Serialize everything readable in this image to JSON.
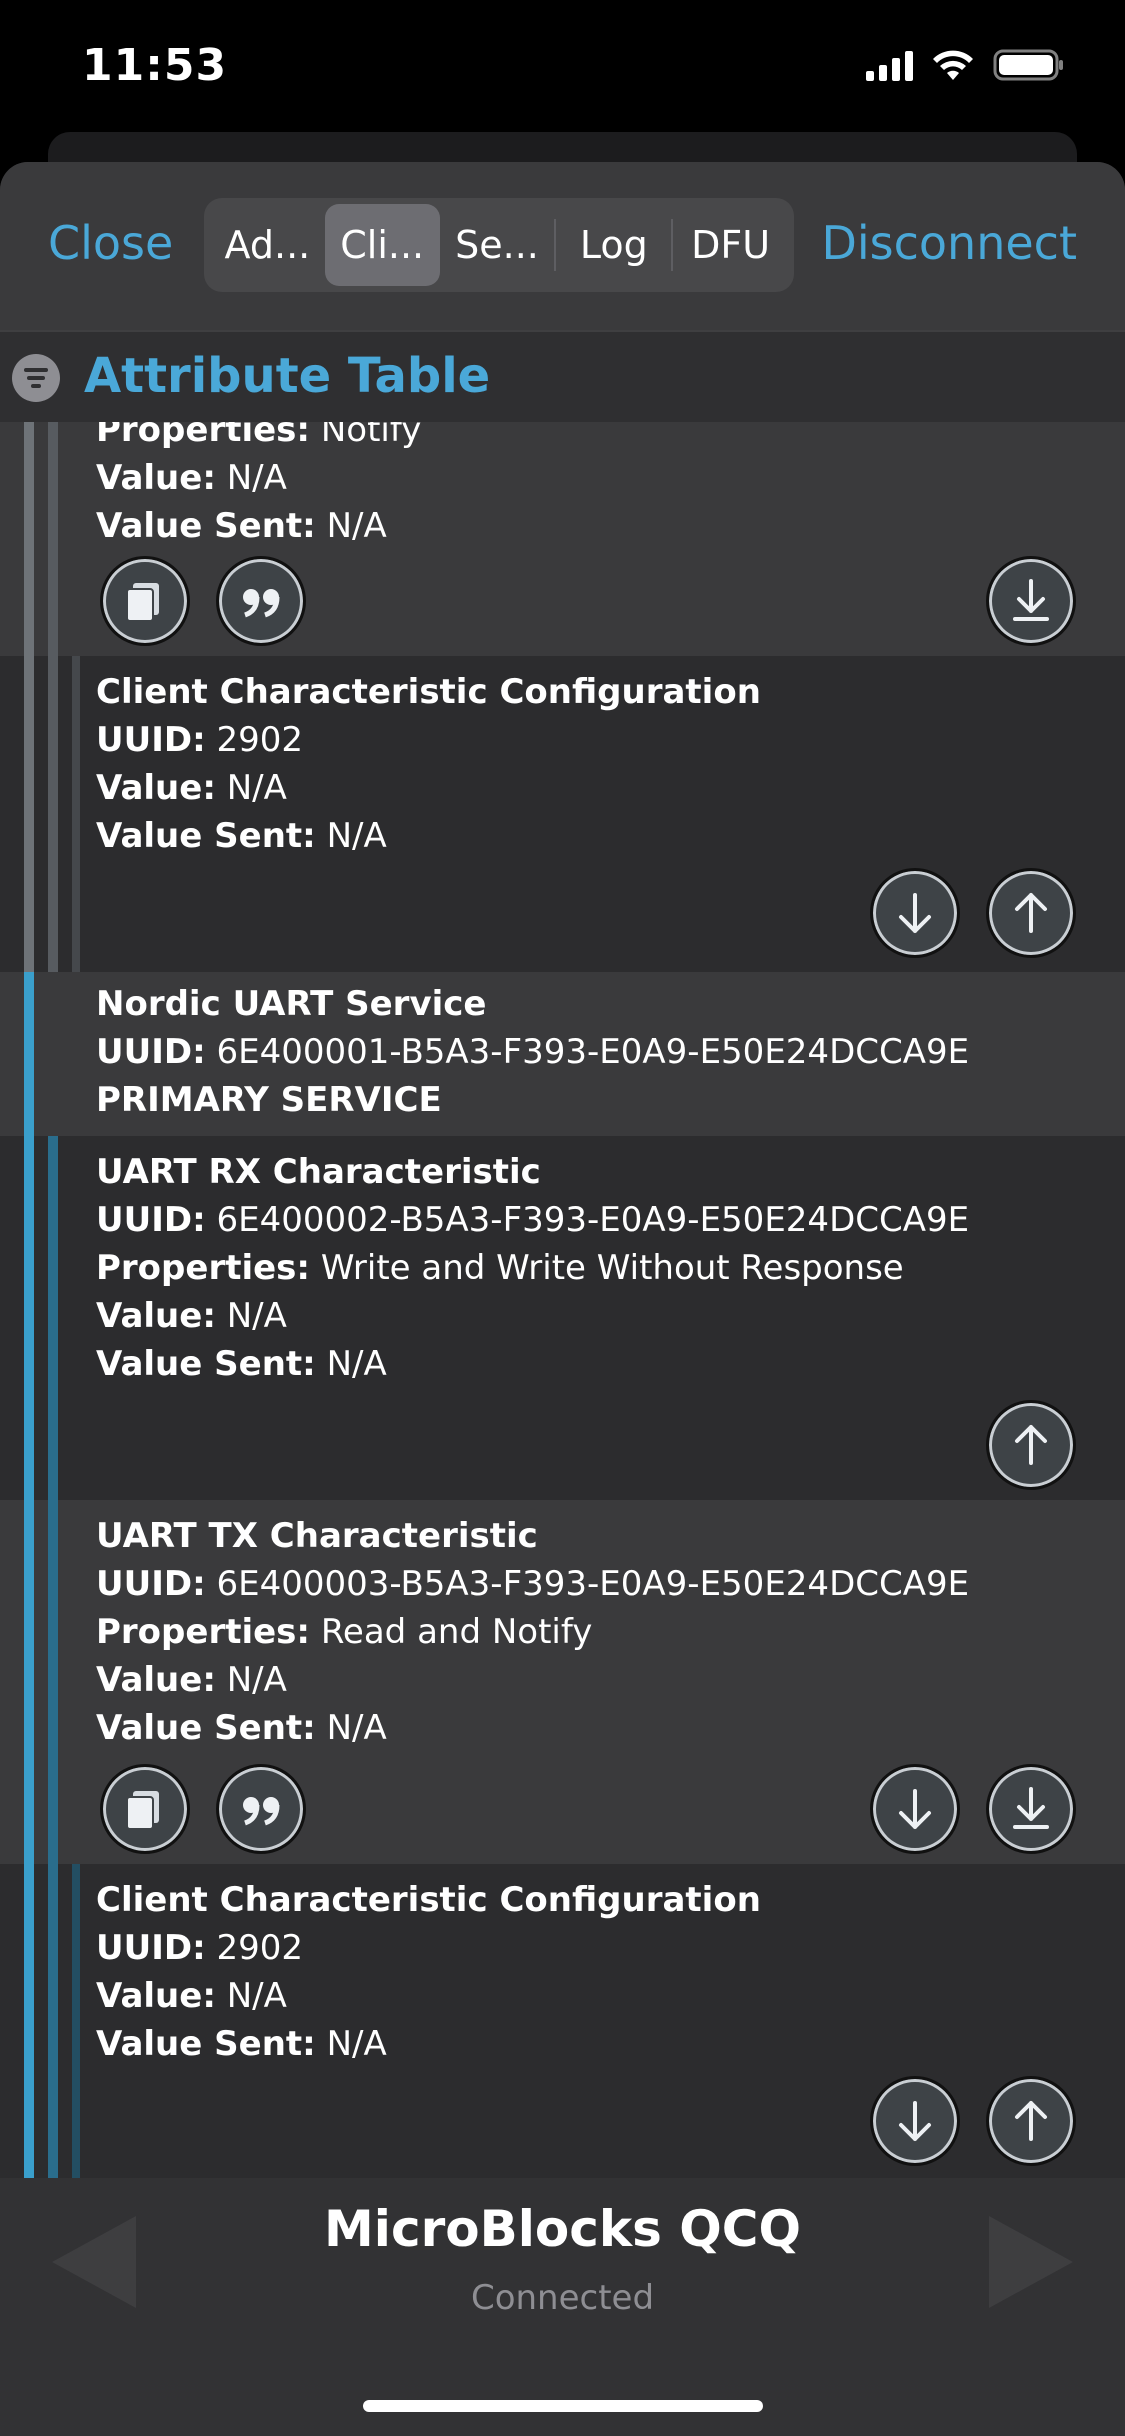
{
  "status_bar": {
    "time": "11:53"
  },
  "nav": {
    "close": "Close",
    "disconnect": "Disconnect",
    "segments": [
      "Ad...",
      "Cli...",
      "Se...",
      "Log",
      "DFU"
    ],
    "active_segment": 1
  },
  "section": {
    "title": "Attribute Table"
  },
  "colors": {
    "accent": "#4aa8d8",
    "gray_bar": "#6e7378",
    "blue_bar": "#3a9fcc",
    "dark_blue_bar": "#2a6d8c"
  },
  "rows": {
    "r0": {
      "properties_label": "Properties:",
      "properties_value": "Notify",
      "value_label": "Value:",
      "value": "N/A",
      "sent_label": "Value Sent:",
      "sent_value": "N/A"
    },
    "r1": {
      "name": "Client Characteristic Configuration",
      "uuid_label": "UUID:",
      "uuid": "2902",
      "value_label": "Value:",
      "value": "N/A",
      "sent_label": "Value Sent:",
      "sent_value": "N/A"
    },
    "r2": {
      "name": "Nordic UART Service",
      "uuid_label": "UUID:",
      "uuid": "6E400001-B5A3-F393-E0A9-E50E24DCCA9E",
      "type": "PRIMARY SERVICE"
    },
    "r3": {
      "name": "UART RX Characteristic",
      "uuid_label": "UUID:",
      "uuid": "6E400002-B5A3-F393-E0A9-E50E24DCCA9E",
      "properties_label": "Properties:",
      "properties_value": "Write and Write Without Response",
      "value_label": "Value:",
      "value": "N/A",
      "sent_label": "Value Sent:",
      "sent_value": "N/A"
    },
    "r4": {
      "name": "UART TX Characteristic",
      "uuid_label": "UUID:",
      "uuid": "6E400003-B5A3-F393-E0A9-E50E24DCCA9E",
      "properties_label": "Properties:",
      "properties_value": "Read and Notify",
      "value_label": "Value:",
      "value": "N/A",
      "sent_label": "Value Sent:",
      "sent_value": "N/A"
    },
    "r5": {
      "name": "Client Characteristic Configuration",
      "uuid_label": "UUID:",
      "uuid": "2902",
      "value_label": "Value:",
      "value": "N/A",
      "sent_label": "Value Sent:",
      "sent_value": "N/A"
    }
  },
  "device": {
    "name": "MicroBlocks QCQ",
    "status": "Connected"
  },
  "icons": [
    "signal-icon",
    "wifi-icon",
    "battery-icon",
    "filter-icon",
    "copy-icon",
    "quote-icon",
    "read-arrow-icon",
    "write-arrow-icon",
    "notify-icon"
  ]
}
